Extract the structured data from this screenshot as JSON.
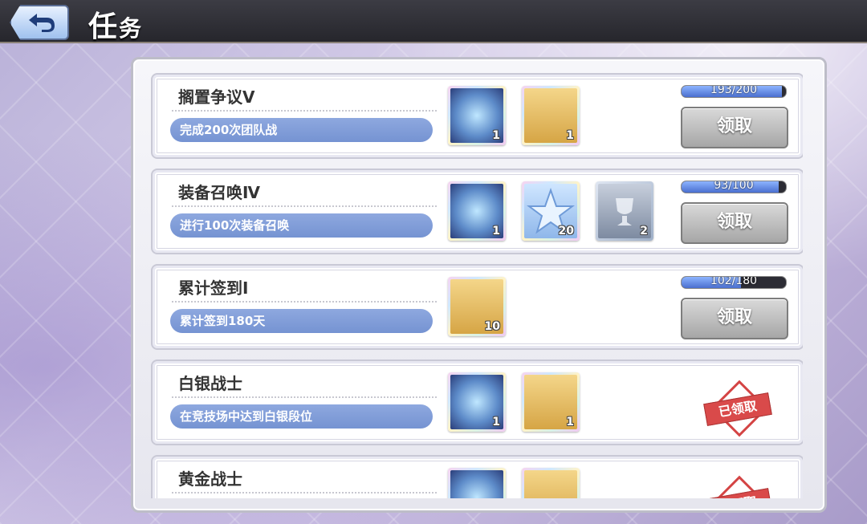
{
  "header": {
    "title_main": "任",
    "title_rest": "务"
  },
  "tasks": [
    {
      "name": "搁置争议Ⅴ",
      "desc": "完成200次团队战",
      "rewards": [
        {
          "icon": "amulet-icon",
          "count": "1"
        },
        {
          "icon": "gold-card-icon",
          "count": "1"
        }
      ],
      "progress": {
        "text": "193/200",
        "fraction": 0.965
      },
      "action": {
        "label": "领取"
      }
    },
    {
      "name": "装备召唤Ⅳ",
      "desc": "进行100次装备召唤",
      "rewards": [
        {
          "icon": "amulet-icon",
          "count": "1"
        },
        {
          "icon": "crystal-star-icon",
          "count": "20"
        },
        {
          "icon": "silver-trophy-card-icon",
          "count": "2"
        }
      ],
      "progress": {
        "text": "93/100",
        "fraction": 0.93
      },
      "action": {
        "label": "领取"
      }
    },
    {
      "name": "累计签到Ⅰ",
      "desc": "累计签到180天",
      "rewards": [
        {
          "icon": "gold-card-icon",
          "count": "10"
        }
      ],
      "progress": {
        "text": "102/180",
        "fraction": 0.567
      },
      "action": {
        "label": "领取"
      }
    },
    {
      "name": "白银战士",
      "desc": "在竞技场中达到白银段位",
      "rewards": [
        {
          "icon": "amulet-icon",
          "count": "1"
        },
        {
          "icon": "gold-card-icon",
          "count": "1"
        }
      ],
      "claimed": {
        "label": "已领取"
      }
    },
    {
      "name": "黄金战士",
      "desc": "",
      "rewards": [
        {
          "icon": "amulet-icon",
          "count": ""
        },
        {
          "icon": "gold-card-icon",
          "count": ""
        }
      ],
      "claimed": {
        "label": "已领取"
      }
    }
  ],
  "colors": {
    "desc_bar": "#7593d2",
    "stamp_red": "#d94a4a",
    "progress_fill": "#4a6fcf"
  }
}
